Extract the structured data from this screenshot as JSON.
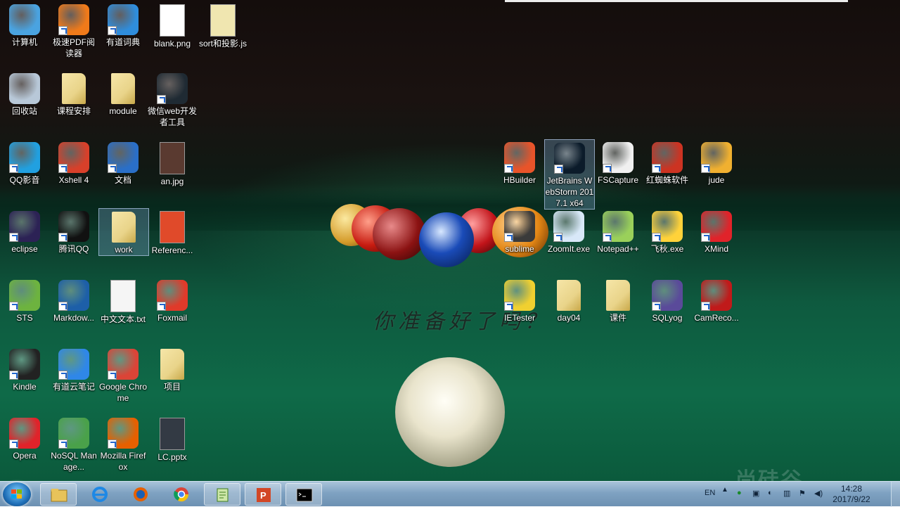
{
  "desktop": {
    "slogan": "你准备好了吗？",
    "watermark": "尚硅谷",
    "icons": [
      {
        "label": "计算机",
        "icon": "computer-icon"
      },
      {
        "label": "极速PDF阅读器",
        "icon": "pdf-reader-icon"
      },
      {
        "label": "有道词典",
        "icon": "youdao-dict-icon"
      },
      {
        "label": "blank.png",
        "icon": "png-file-icon"
      },
      {
        "label": "sort和投影.js",
        "icon": "js-file-icon"
      },
      {
        "label": "回收站",
        "icon": "recycle-bin-icon"
      },
      {
        "label": "课程安排",
        "icon": "folder-icon"
      },
      {
        "label": "module",
        "icon": "folder-icon"
      },
      {
        "label": "微信web开发者工具",
        "icon": "wechat-devtools-icon"
      },
      {
        "label": "QQ影音",
        "icon": "qq-player-icon"
      },
      {
        "label": "Xshell 4",
        "icon": "xshell-icon"
      },
      {
        "label": "文档",
        "icon": "help-icon"
      },
      {
        "label": "an.jpg",
        "icon": "jpg-file-icon"
      },
      {
        "label": "eclipse",
        "icon": "eclipse-icon"
      },
      {
        "label": "腾讯QQ",
        "icon": "qq-icon"
      },
      {
        "label": "work",
        "icon": "folder-icon"
      },
      {
        "label": "Referenc...",
        "icon": "pdf-file-icon"
      },
      {
        "label": "STS",
        "icon": "sts-icon"
      },
      {
        "label": "Markdow...",
        "icon": "markdown-icon"
      },
      {
        "label": "中文文本.txt",
        "icon": "txt-file-icon"
      },
      {
        "label": "Foxmail",
        "icon": "foxmail-icon"
      },
      {
        "label": "Kindle",
        "icon": "kindle-icon"
      },
      {
        "label": "有道云笔记",
        "icon": "youdao-note-icon"
      },
      {
        "label": "Google Chrome",
        "icon": "chrome-icon"
      },
      {
        "label": "项目",
        "icon": "folder-icon"
      },
      {
        "label": "Opera",
        "icon": "opera-icon"
      },
      {
        "label": "NoSQL Manage...",
        "icon": "nosql-icon"
      },
      {
        "label": "Mozilla Firefox",
        "icon": "firefox-icon"
      },
      {
        "label": "LC.pptx",
        "icon": "pptx-file-icon"
      },
      {
        "label": "HBuilder",
        "icon": "hbuilder-icon"
      },
      {
        "label": "JetBrains WebStorm 2017.1 x64",
        "icon": "webstorm-icon"
      },
      {
        "label": "FSCapture",
        "icon": "fscapture-icon"
      },
      {
        "label": "红蜘蛛软件",
        "icon": "red-spider-icon"
      },
      {
        "label": "jude",
        "icon": "jude-icon"
      },
      {
        "label": "sublime",
        "icon": "sublime-icon"
      },
      {
        "label": "ZoomIt.exe",
        "icon": "zoomit-icon"
      },
      {
        "label": "Notepad++",
        "icon": "notepadpp-icon"
      },
      {
        "label": "飞秋.exe",
        "icon": "feiq-icon"
      },
      {
        "label": "XMind",
        "icon": "xmind-icon"
      },
      {
        "label": "IETester",
        "icon": "ietester-icon"
      },
      {
        "label": "day04",
        "icon": "folder-icon"
      },
      {
        "label": "课件",
        "icon": "folder-icon"
      },
      {
        "label": "SQLyog",
        "icon": "sqlyog-icon"
      },
      {
        "label": "CamReco...",
        "icon": "camrec-icon"
      }
    ]
  },
  "taskbar": {
    "pinned": [
      "explorer-icon",
      "ie-icon",
      "firefox-icon",
      "chrome-icon",
      "notepadpp-icon",
      "powerpoint-icon",
      "cmd-icon"
    ],
    "tray": {
      "lang": "EN",
      "time": "14:28",
      "date": "2017/9/22"
    }
  },
  "colors": {
    "accent": "#1f6fb8",
    "felt": "#0f6a48",
    "taskbar": "#7fa2c2"
  }
}
